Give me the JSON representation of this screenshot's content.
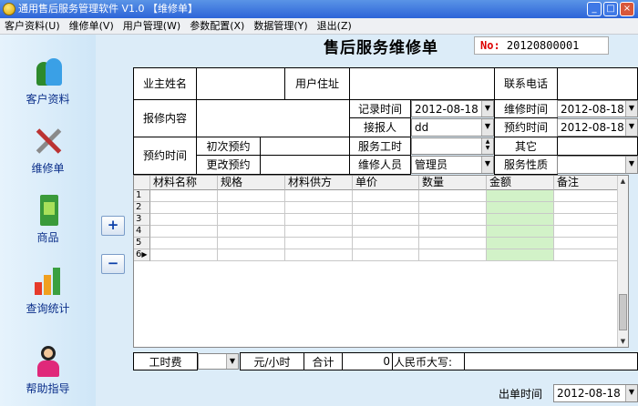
{
  "window": {
    "title": "通用售后服务管理软件 V1.0 【维修单】",
    "btn_min": "_",
    "btn_max": "□",
    "btn_close": "×"
  },
  "menu": [
    "客户资料(U)",
    "维修单(V)",
    "用户管理(W)",
    "参数配置(X)",
    "数据管理(Y)",
    "退出(Z)"
  ],
  "sidebar": [
    {
      "label": "客户资料",
      "icon": "customers-icon"
    },
    {
      "label": "维修单",
      "icon": "tools-icon"
    },
    {
      "label": "商品",
      "icon": "goods-icon"
    },
    {
      "label": "查询统计",
      "icon": "statistics-icon"
    },
    {
      "label": "帮助指导",
      "icon": "help-icon"
    }
  ],
  "buttons": {
    "add": "+",
    "remove": "−"
  },
  "form": {
    "title": "售后服务维修单",
    "no_label": "No:",
    "no_value": "20120800001",
    "owner_label": "业主姓名",
    "address_label": "用户住址",
    "phone_label": "联系电话",
    "record_time_label": "记录时间",
    "record_time": "2012-08-18",
    "repair_time_label": "维修时间",
    "repair_time": "2012-08-18",
    "repair_content_label": "报修内容",
    "receiver_label": "接报人",
    "receiver": "dd",
    "appoint_time_label": "预约时间",
    "appoint_time": "2012-08-18",
    "appt_label": "预约时间",
    "first_appt_label": "初次预约",
    "service_hours_label": "服务工时",
    "other_label": "其它",
    "change_appt_label": "更改预约",
    "staff_label": "维修人员",
    "staff": "管理员",
    "service_type_label": "服务性质"
  },
  "grid": {
    "columns": [
      "材料名称",
      "规格",
      "材料供方",
      "单价",
      "数量",
      "金额",
      "备注"
    ],
    "rows": [
      "1",
      "2",
      "3",
      "4",
      "5",
      "6"
    ]
  },
  "footer": {
    "labor_fee_label": "工时费",
    "unit_label": "元/小时",
    "total_label": "合计",
    "total_value": "0",
    "rmb_label": "人民币大写:",
    "issue_time_label": "出单时间",
    "issue_time": "2012-08-18"
  },
  "colors": {
    "accent": "#2d64d8",
    "highlight_green": "#d2f2c8",
    "background": "#dcecf8"
  }
}
